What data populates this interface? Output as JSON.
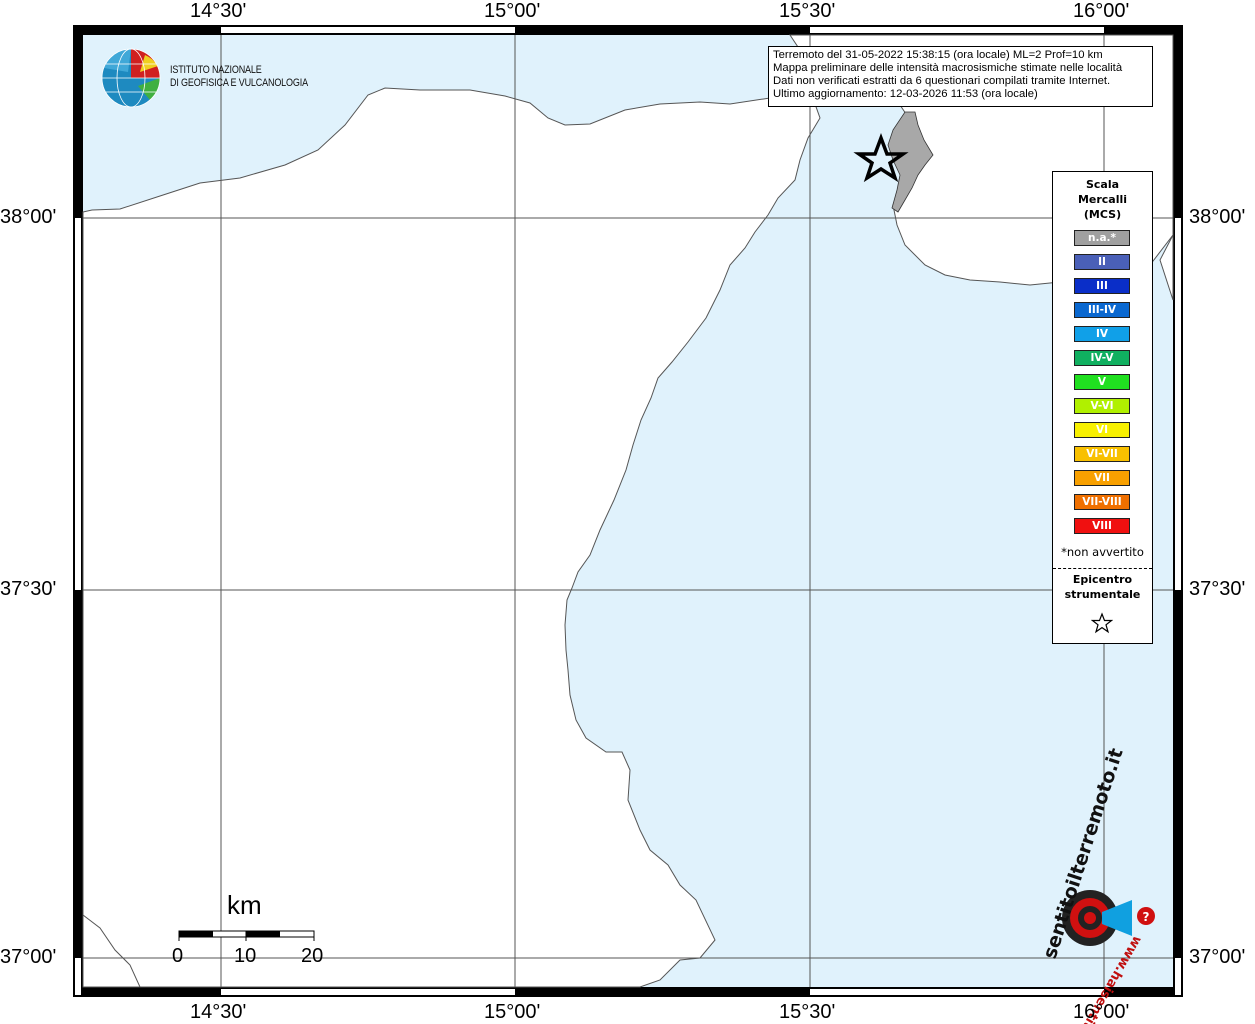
{
  "map": {
    "lon_labels": [
      "14°30'",
      "15°00'",
      "15°30'",
      "16°00'"
    ],
    "lat_labels": [
      "38°00'",
      "37°30'",
      "37°00'"
    ],
    "colors": {
      "sea": "#e0f2fc",
      "land": "#ffffff",
      "coast": "#555555",
      "grid": "#555555",
      "felt": "#a8a8a8"
    }
  },
  "logo": {
    "icon": "ingv-globe-icon",
    "line1": "ISTITUTO NAZIONALE",
    "line2": "DI GEOFISICA E VULCANOLOGIA"
  },
  "info": {
    "line1": "Terremoto del 31-05-2022 15:38:15 (ora locale) ML=2 Prof=10 km",
    "line2": "Mappa preliminare delle intensità macrosismiche stimate nelle località",
    "line3": "Dati non verificati estratti da 6 questionari compilati tramite Internet.",
    "line4": "Ultimo aggiornamento: 12-03-2026 11:53 (ora locale)"
  },
  "legend": {
    "title_line1": "Scala",
    "title_line2": "Mercalli",
    "title_line3": "(MCS)",
    "items": [
      {
        "label": "n.a.*",
        "color": "#a0a0a0"
      },
      {
        "label": "II",
        "color": "#4a60b8"
      },
      {
        "label": "III",
        "color": "#0a2ec8"
      },
      {
        "label": "III-IV",
        "color": "#0a68d0"
      },
      {
        "label": "IV",
        "color": "#10a0e8"
      },
      {
        "label": "IV-V",
        "color": "#10b060"
      },
      {
        "label": "V",
        "color": "#20e020"
      },
      {
        "label": "V-VI",
        "color": "#b0f000"
      },
      {
        "label": "VI",
        "color": "#f8f000"
      },
      {
        "label": "VI-VII",
        "color": "#f8c000"
      },
      {
        "label": "VII",
        "color": "#f8a000"
      },
      {
        "label": "VII-VIII",
        "color": "#f07000"
      },
      {
        "label": "VIII",
        "color": "#f01010"
      }
    ],
    "note": "*non avvertito",
    "epicenter_line1": "Epicentro",
    "epicenter_line2": "strumentale",
    "epicenter_icon": "star-icon"
  },
  "scale_bar": {
    "unit": "km",
    "ticks": [
      "0",
      "10",
      "20"
    ]
  },
  "watermark": {
    "text_main": "sentitoilterremoto.it",
    "text_sub": "www.haisentito",
    "icon": "haisentito-logo-icon"
  }
}
